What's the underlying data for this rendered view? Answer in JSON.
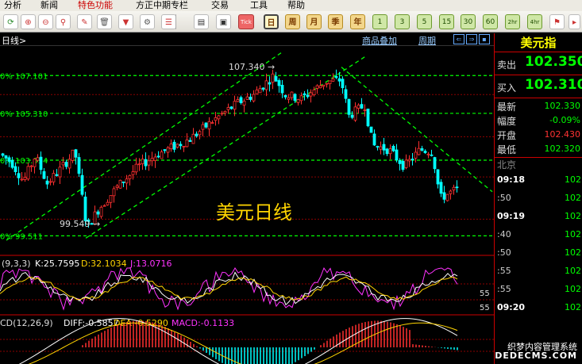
{
  "menu": [
    "分析",
    "新闻",
    "特色功能",
    "方正中期专栏",
    "交易",
    "工具",
    "帮助"
  ],
  "toolbar": {
    "icons": [
      "refresh-icon",
      "zoom-in-icon",
      "zoom-out-icon",
      "magnify-icon",
      "pen-icon",
      "trash-icon",
      "filter-icon",
      "settings-icon",
      "list-icon",
      "window-icon",
      "tick-icon"
    ],
    "tick_label": "Tick",
    "periods": [
      "日",
      "周",
      "月",
      "季",
      "年"
    ],
    "minutes": [
      "1",
      "3",
      "5",
      "15",
      "30",
      "60",
      "2hr",
      "4hr"
    ]
  },
  "header": {
    "period": "日线>",
    "overlay": "商品叠加",
    "cycle": "周期"
  },
  "chart_title": "美元日线",
  "price_labels": {
    "high": "107.340 →",
    "low": "99.549 →"
  },
  "fib_levels": [
    {
      "label": "0% 107.101",
      "value": 107.101
    },
    {
      "label": "0% 105.310",
      "value": 105.31
    },
    {
      "label": "0% 103.094",
      "value": 103.094
    },
    {
      "label": "0% 99.511",
      "value": 99.511
    }
  ],
  "kdj": {
    "title": "(9,3,3)",
    "k": "K:25.7595",
    "d": "D:32.1034",
    "j": "J:13.0716",
    "axis": [
      "55",
      "55"
    ]
  },
  "macd": {
    "title": "CD(12,26,9)",
    "diff": "DIFF:-0.5857",
    "dea": "DEA:-0.5290",
    "macd": "MACD:-0.1133"
  },
  "panel": {
    "title": "美元指",
    "sell_label": "卖出",
    "sell_value": "102.350",
    "buy_label": "买入",
    "buy_value": "102.310",
    "rows": [
      {
        "label": "最新",
        "value": "102.330",
        "color": "#0f0"
      },
      {
        "label": "幅度",
        "value": "-0.09%",
        "color": "#0f0"
      },
      {
        "label": "开盘",
        "value": "102.430",
        "color": "#f33"
      },
      {
        "label": "最低",
        "value": "102.320",
        "color": "#0f0"
      }
    ],
    "region": "北京",
    "ticks": [
      {
        "time": "09:18",
        "value": "102",
        "bold": true
      },
      {
        "time": ":50",
        "value": "102",
        "bold": false
      },
      {
        "time": "09:19",
        "value": "102",
        "bold": true
      },
      {
        "time": ":40",
        "value": "102",
        "bold": false
      },
      {
        "time": ":50",
        "value": "102",
        "bold": false
      },
      {
        "time": ":55",
        "value": "102",
        "bold": false
      },
      {
        "time": ":55",
        "value": "102",
        "bold": false
      },
      {
        "time": "09:20",
        "value": "102",
        "bold": true
      }
    ]
  },
  "watermark": [
    "织梦内容管理系统",
    "DEDECMS.COM"
  ],
  "chart_data": {
    "type": "candlestick",
    "price_ylim": [
      99.0,
      108.2
    ],
    "kdj_ylim": [
      0,
      100
    ],
    "colors": {
      "up": "#ff3030",
      "down": "#00ffff",
      "trend": "#00ff00",
      "k": "#ffffff",
      "d": "#ffd400",
      "j": "#ff33ff",
      "grid": "#8b0000"
    }
  }
}
